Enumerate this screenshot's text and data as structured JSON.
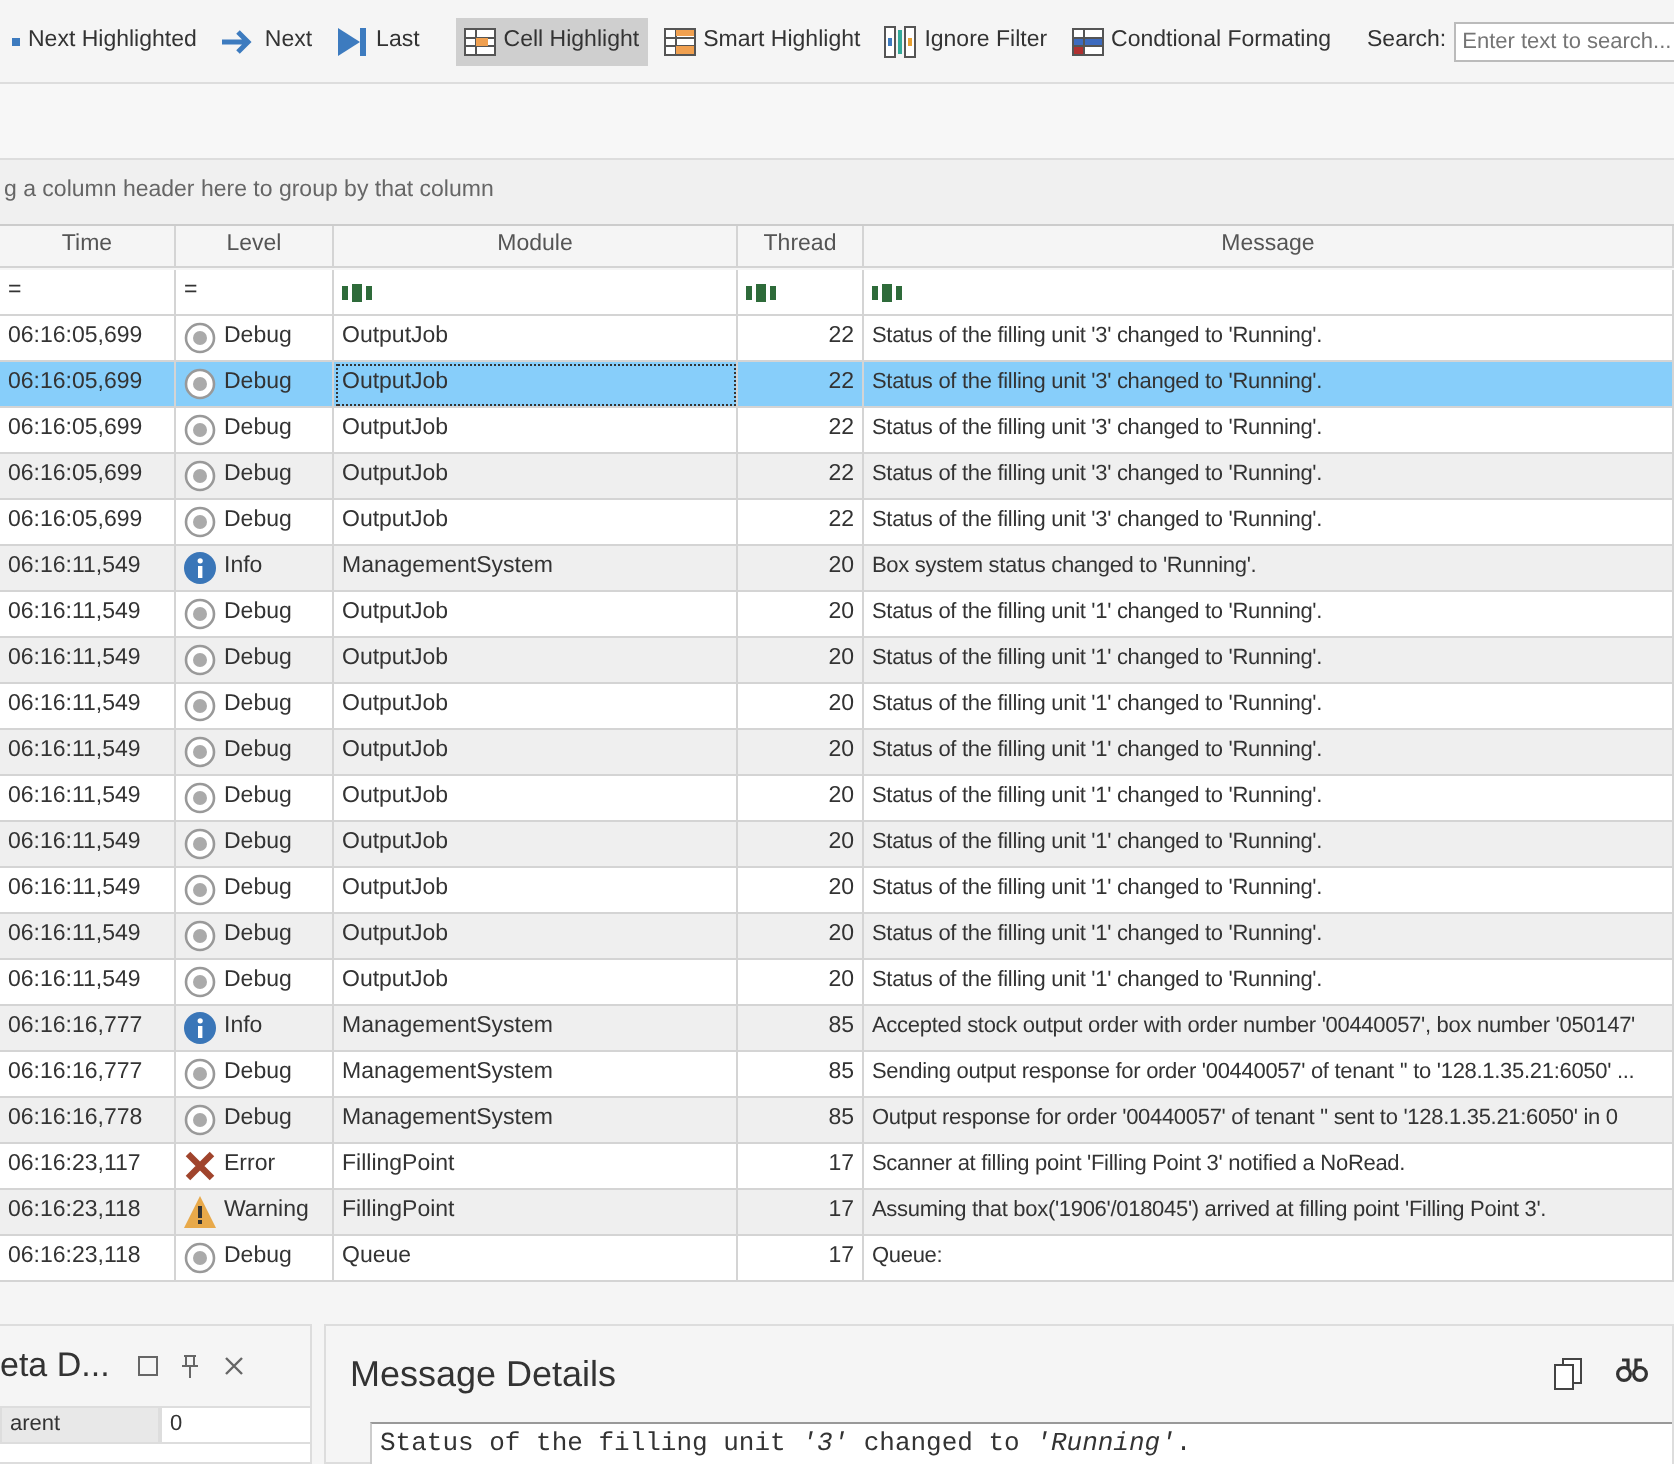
{
  "toolbar": {
    "items": [
      {
        "kind": "partial",
        "label": "Next Highlighted",
        "selected": false
      },
      {
        "kind": "next",
        "label": "Next",
        "selected": false
      },
      {
        "kind": "last",
        "label": "Last",
        "selected": false
      },
      {
        "kind": "separator"
      },
      {
        "kind": "cell",
        "label": "Cell Highlight",
        "selected": true
      },
      {
        "kind": "smart",
        "label": "Smart Highlight",
        "selected": false
      },
      {
        "kind": "ignore",
        "label": "Ignore Filter",
        "selected": false
      },
      {
        "kind": "conditional",
        "label": "Condtional Formating",
        "selected": false
      },
      {
        "kind": "separator"
      }
    ],
    "search": {
      "label": "Search:",
      "placeholder": "Enter text to search..."
    }
  },
  "group_panel": {
    "hint": "g a column header here to group by that column"
  },
  "table": {
    "columns": [
      {
        "label": "Time",
        "filter_symbol": "="
      },
      {
        "label": "Level",
        "filter_symbol": "="
      },
      {
        "label": "Module",
        "text_filter": true
      },
      {
        "label": "Thread",
        "text_filter": true
      },
      {
        "label": "Message",
        "text_filter": true
      }
    ],
    "rows": [
      {
        "time": "06:16:05,699",
        "level": "Debug",
        "kind": "debug",
        "module": "OutputJob",
        "thread": "22",
        "message": "Status of the filling unit '3' changed to 'Running'.",
        "selected": false
      },
      {
        "time": "06:16:05,699",
        "level": "Debug",
        "kind": "debug",
        "module": "OutputJob",
        "thread": "22",
        "message": "Status of the filling unit '3' changed to 'Running'.",
        "selected": true
      },
      {
        "time": "06:16:05,699",
        "level": "Debug",
        "kind": "debug",
        "module": "OutputJob",
        "thread": "22",
        "message": "Status of the filling unit '3' changed to 'Running'.",
        "selected": false
      },
      {
        "time": "06:16:05,699",
        "level": "Debug",
        "kind": "debug",
        "module": "OutputJob",
        "thread": "22",
        "message": "Status of the filling unit '3' changed to 'Running'.",
        "selected": false
      },
      {
        "time": "06:16:05,699",
        "level": "Debug",
        "kind": "debug",
        "module": "OutputJob",
        "thread": "22",
        "message": "Status of the filling unit '3' changed to 'Running'.",
        "selected": false
      },
      {
        "time": "06:16:11,549",
        "level": "Info",
        "kind": "info",
        "module": "ManagementSystem",
        "thread": "20",
        "message": "Box system status changed to 'Running'.",
        "selected": false
      },
      {
        "time": "06:16:11,549",
        "level": "Debug",
        "kind": "debug",
        "module": "OutputJob",
        "thread": "20",
        "message": "Status of the filling unit '1' changed to 'Running'.",
        "selected": false
      },
      {
        "time": "06:16:11,549",
        "level": "Debug",
        "kind": "debug",
        "module": "OutputJob",
        "thread": "20",
        "message": "Status of the filling unit '1' changed to 'Running'.",
        "selected": false
      },
      {
        "time": "06:16:11,549",
        "level": "Debug",
        "kind": "debug",
        "module": "OutputJob",
        "thread": "20",
        "message": "Status of the filling unit '1' changed to 'Running'.",
        "selected": false
      },
      {
        "time": "06:16:11,549",
        "level": "Debug",
        "kind": "debug",
        "module": "OutputJob",
        "thread": "20",
        "message": "Status of the filling unit '1' changed to 'Running'.",
        "selected": false
      },
      {
        "time": "06:16:11,549",
        "level": "Debug",
        "kind": "debug",
        "module": "OutputJob",
        "thread": "20",
        "message": "Status of the filling unit '1' changed to 'Running'.",
        "selected": false
      },
      {
        "time": "06:16:11,549",
        "level": "Debug",
        "kind": "debug",
        "module": "OutputJob",
        "thread": "20",
        "message": "Status of the filling unit '1' changed to 'Running'.",
        "selected": false
      },
      {
        "time": "06:16:11,549",
        "level": "Debug",
        "kind": "debug",
        "module": "OutputJob",
        "thread": "20",
        "message": "Status of the filling unit '1' changed to 'Running'.",
        "selected": false
      },
      {
        "time": "06:16:11,549",
        "level": "Debug",
        "kind": "debug",
        "module": "OutputJob",
        "thread": "20",
        "message": "Status of the filling unit '1' changed to 'Running'.",
        "selected": false
      },
      {
        "time": "06:16:11,549",
        "level": "Debug",
        "kind": "debug",
        "module": "OutputJob",
        "thread": "20",
        "message": "Status of the filling unit '1' changed to 'Running'.",
        "selected": false
      },
      {
        "time": "06:16:16,777",
        "level": "Info",
        "kind": "info",
        "module": "ManagementSystem",
        "thread": "85",
        "message": "Accepted stock output order with order number '00440057', box number '050147'",
        "selected": false
      },
      {
        "time": "06:16:16,777",
        "level": "Debug",
        "kind": "debug",
        "module": "ManagementSystem",
        "thread": "85",
        "message": "Sending output response for order '00440057' of tenant '' to '128.1.35.21:6050' ...",
        "selected": false
      },
      {
        "time": "06:16:16,778",
        "level": "Debug",
        "kind": "debug",
        "module": "ManagementSystem",
        "thread": "85",
        "message": "Output response for order '00440057' of tenant '' sent to '128.1.35.21:6050' in 0",
        "selected": false
      },
      {
        "time": "06:16:23,117",
        "level": "Error",
        "kind": "error",
        "module": "FillingPoint",
        "thread": "17",
        "message": "Scanner at filling point 'Filling Point 3' notified a NoRead.",
        "selected": false
      },
      {
        "time": "06:16:23,118",
        "level": "Warning",
        "kind": "warning",
        "module": "FillingPoint",
        "thread": "17",
        "message": "Assuming that box('1906'/018045') arrived at filling point 'Filling Point 3'.",
        "selected": false
      },
      {
        "time": "06:16:23,118",
        "level": "Debug",
        "kind": "debug",
        "module": "Queue",
        "thread": "17",
        "message": "Queue:",
        "selected": false
      }
    ]
  },
  "meta_panel": {
    "title": "eta D...",
    "properties": [
      {
        "name": "arent",
        "value": "0"
      }
    ]
  },
  "message_details": {
    "title": "Message Details",
    "text": "Status of the filling unit *'3'* changed to *'Running'*."
  }
}
